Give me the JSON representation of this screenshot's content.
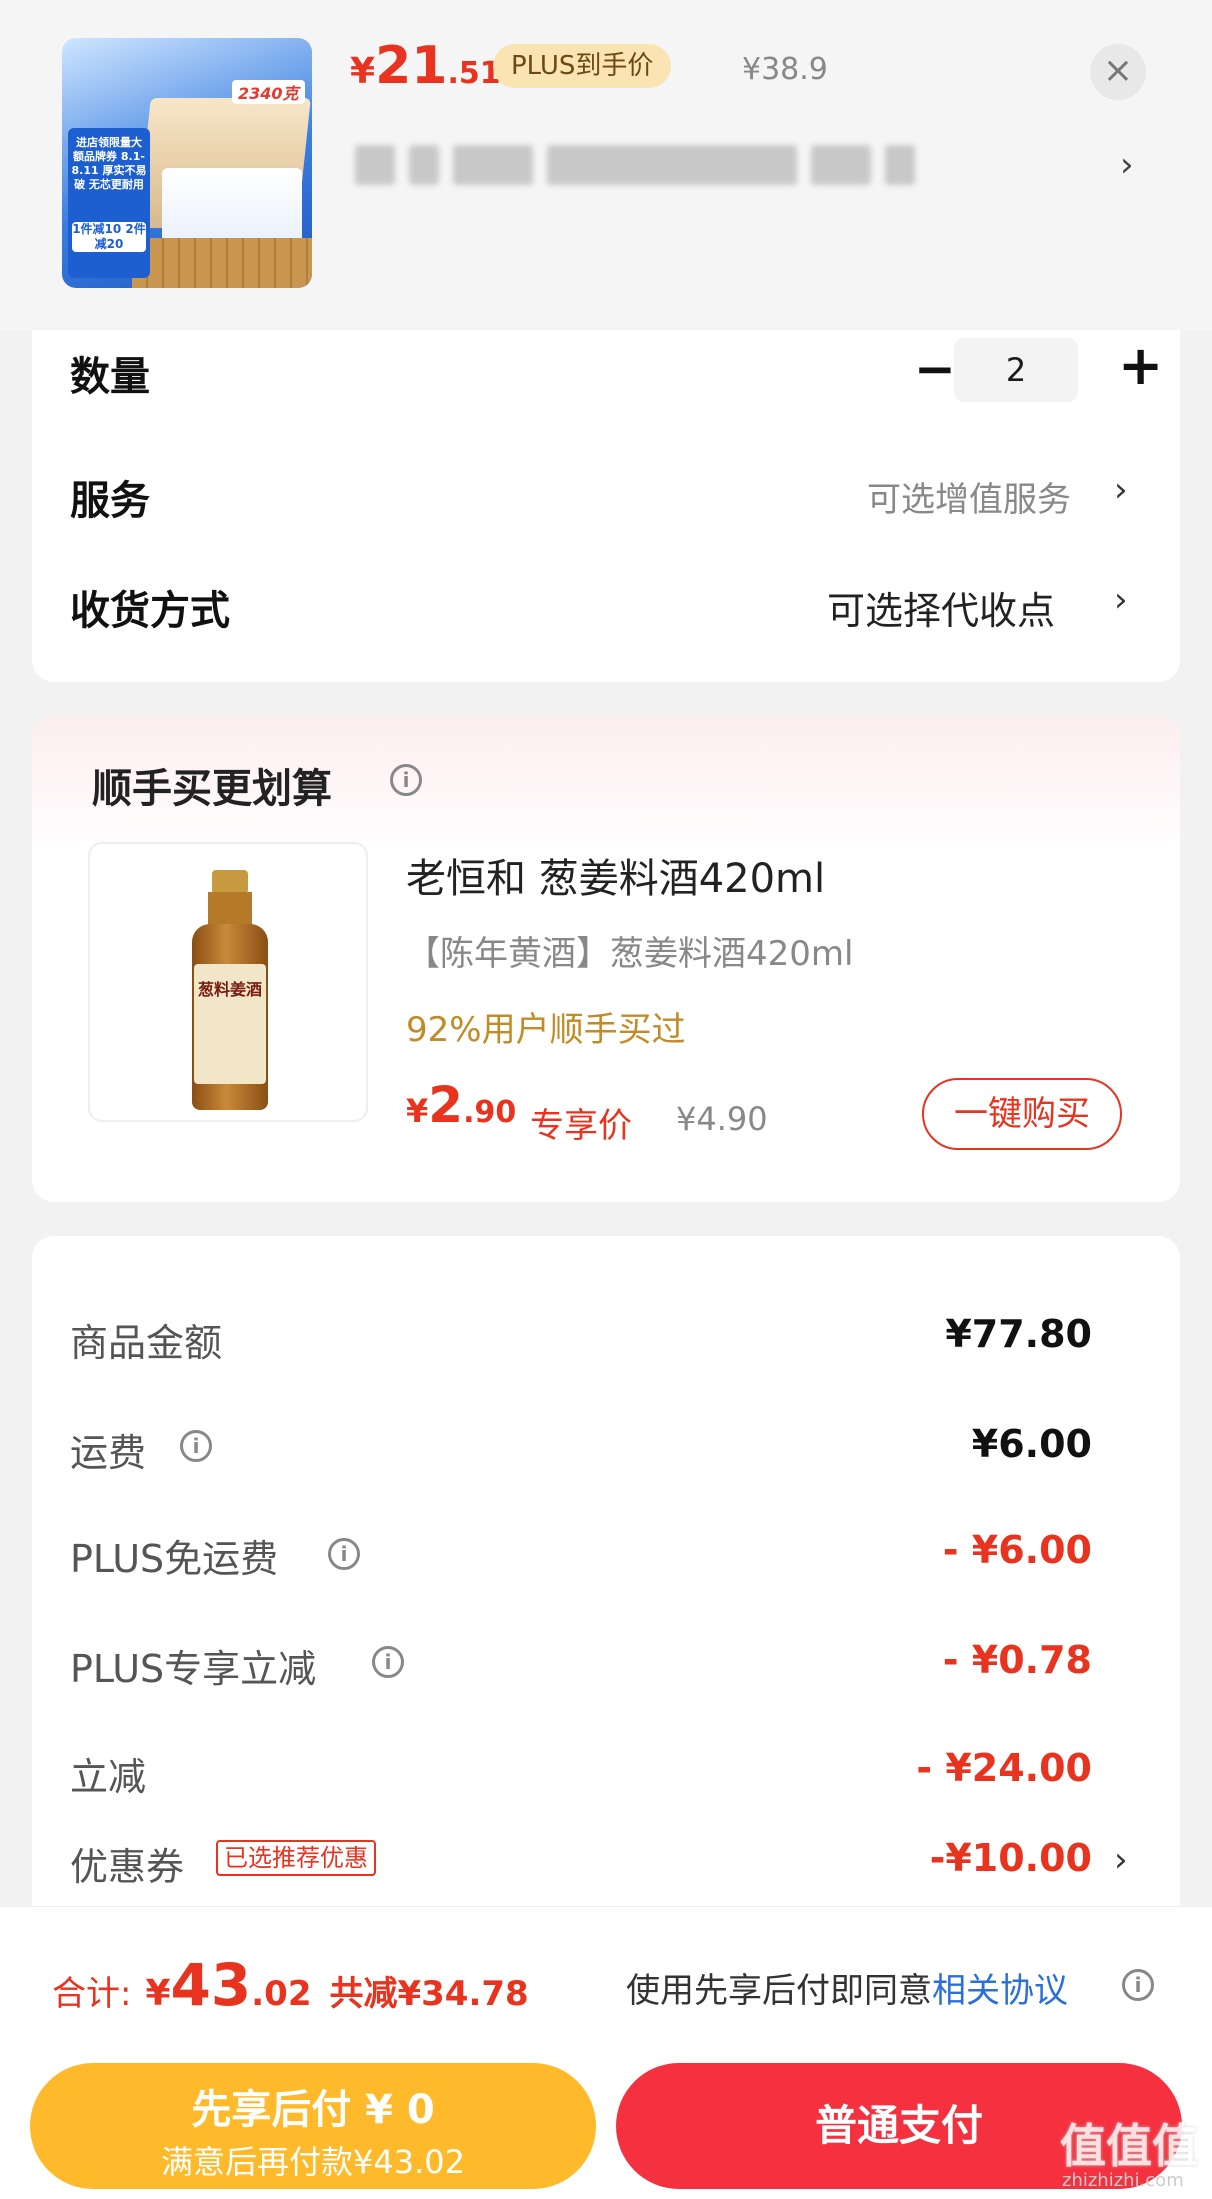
{
  "header": {
    "price": {
      "currency": "¥",
      "int": "21",
      "dec": ".51"
    },
    "plus_badge": "PLUS到手价",
    "original_price": "¥38.9",
    "close_icon": "×",
    "spec_arrow": "›",
    "thumbnail": {
      "weight": "2340克",
      "tag_text": "进店领限量大额品牌券 8.1-8.11 厚实不易破 无芯更耐用",
      "promo": "1件减10 2件减20"
    }
  },
  "quantity": {
    "label": "数量",
    "minus": "−",
    "value": "2",
    "plus": "+"
  },
  "service": {
    "label": "服务",
    "value": "可选增值服务",
    "chevron": "›"
  },
  "delivery": {
    "label": "收货方式",
    "value": "可选择代收点",
    "chevron": "›"
  },
  "addon": {
    "title": "顺手买更划算",
    "info_icon": "i",
    "product": {
      "name": "老恒和 葱姜料酒420ml",
      "subtitle": "【陈年黄酒】葱姜料酒420ml",
      "bought_note": "92%用户顺手买过",
      "price_currency": "¥",
      "price_int": "2",
      "price_dec": ".90",
      "exclusive_label": "专享价",
      "original_price": "¥4.90",
      "buy_button": "一键购买",
      "bottle_label": "葱料姜酒"
    }
  },
  "summary": {
    "rows": [
      {
        "label": "商品金额",
        "value": "¥77.80",
        "info": false,
        "red": false
      },
      {
        "label": "运费",
        "value": "¥6.00",
        "info": true,
        "red": false
      },
      {
        "label": "PLUS免运费",
        "value": "- ¥6.00",
        "info": true,
        "red": true
      },
      {
        "label": "PLUS专享立减",
        "value": "- ¥0.78",
        "info": true,
        "red": true
      },
      {
        "label": "立减",
        "value": "- ¥24.00",
        "info": false,
        "red": true
      },
      {
        "label": "优惠券",
        "value": "-¥10.00",
        "info": false,
        "red": true
      }
    ],
    "coupon_tag": "已选推荐优惠",
    "coupon_chevron": "›"
  },
  "bottom": {
    "total_label": "合计:",
    "total_currency": "¥",
    "total_int": "43",
    "total_dec": ".02",
    "saved": "共减¥34.78",
    "agree_text": "使用先享后付即同意",
    "agree_link": "相关协议",
    "bnpl_title": "先享后付 ¥ 0",
    "bnpl_sub": "满意后再付款¥43.02",
    "pay_button": "普通支付",
    "watermark": "值值值",
    "watermark_sub": "zhizhizhi.com"
  },
  "colors": {
    "accent_red": "#e8331f",
    "bnpl_yellow": "#ffba2b",
    "pay_red": "#f5303f",
    "link_blue": "#2b6fd8",
    "gold": "#c28b25"
  }
}
